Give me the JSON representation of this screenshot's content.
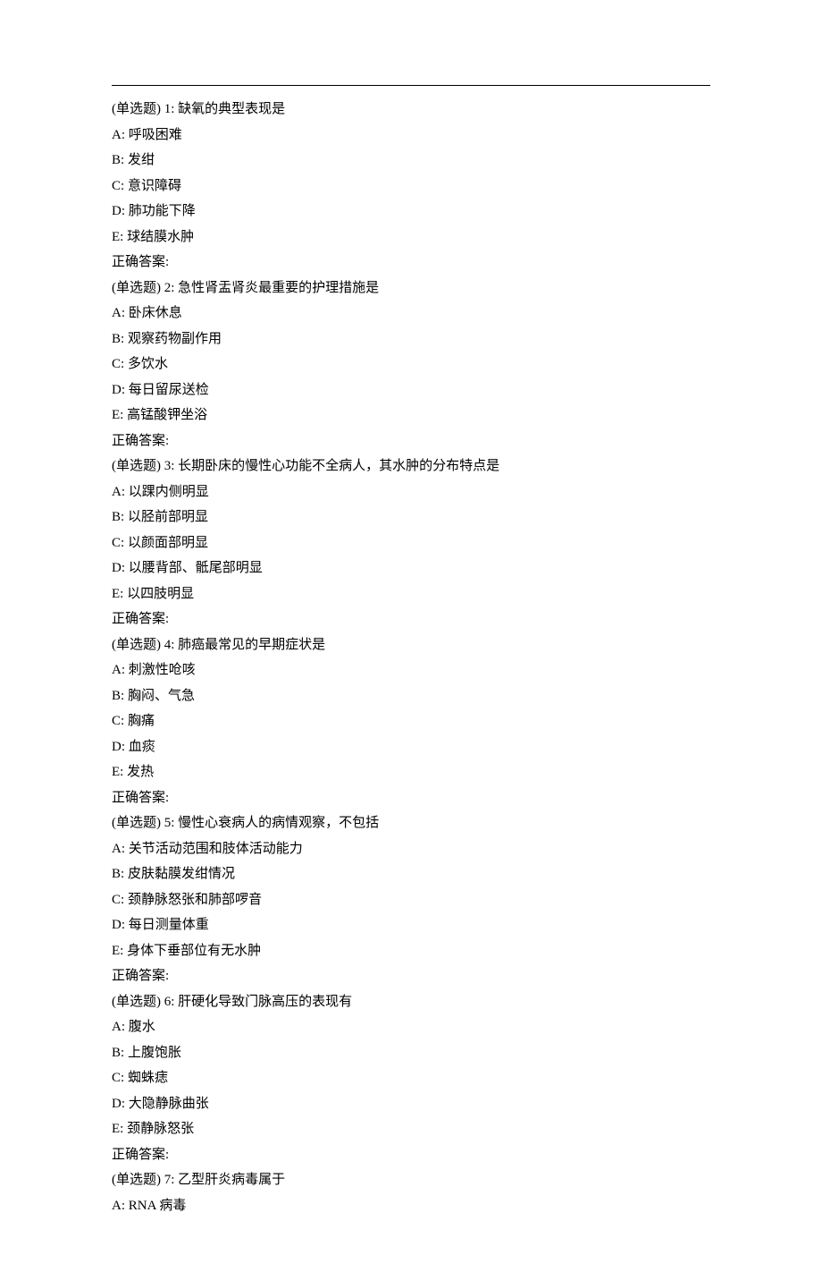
{
  "questions": [
    {
      "prefix": "(单选题)",
      "num": "1:",
      "stem": "缺氧的典型表现是",
      "options": [
        {
          "key": "A:",
          "text": "呼吸困难"
        },
        {
          "key": "B:",
          "text": "发绀"
        },
        {
          "key": "C:",
          "text": "意识障碍"
        },
        {
          "key": "D:",
          "text": "肺功能下降"
        },
        {
          "key": "E:",
          "text": "球结膜水肿"
        }
      ],
      "answer_label": "正确答案:"
    },
    {
      "prefix": "(单选题)",
      "num": "2:",
      "stem": "急性肾盂肾炎最重要的护理措施是",
      "options": [
        {
          "key": "A:",
          "text": "卧床休息"
        },
        {
          "key": "B:",
          "text": "观察药物副作用"
        },
        {
          "key": "C:",
          "text": "多饮水"
        },
        {
          "key": "D:",
          "text": "每日留尿送检"
        },
        {
          "key": "E:",
          "text": "高锰酸钾坐浴"
        }
      ],
      "answer_label": "正确答案:"
    },
    {
      "prefix": "(单选题)",
      "num": "3:",
      "stem": "长期卧床的慢性心功能不全病人，其水肿的分布特点是",
      "options": [
        {
          "key": "A:",
          "text": "以踝内侧明显"
        },
        {
          "key": "B:",
          "text": "以胫前部明显"
        },
        {
          "key": "C:",
          "text": "以颜面部明显"
        },
        {
          "key": "D:",
          "text": "以腰背部、骶尾部明显"
        },
        {
          "key": "E:",
          "text": "以四肢明显"
        }
      ],
      "answer_label": "正确答案:"
    },
    {
      "prefix": "(单选题)",
      "num": "4:",
      "stem": "肺癌最常见的早期症状是",
      "options": [
        {
          "key": "A:",
          "text": "刺激性呛咳"
        },
        {
          "key": "B:",
          "text": "胸闷、气急"
        },
        {
          "key": "C:",
          "text": "胸痛"
        },
        {
          "key": "D:",
          "text": "血痰"
        },
        {
          "key": "E:",
          "text": "发热"
        }
      ],
      "answer_label": "正确答案:"
    },
    {
      "prefix": "(单选题)",
      "num": "5:",
      "stem": "慢性心衰病人的病情观察，不包括",
      "options": [
        {
          "key": "A:",
          "text": "关节活动范围和肢体活动能力"
        },
        {
          "key": "B:",
          "text": "皮肤黏膜发绀情况"
        },
        {
          "key": "C:",
          "text": "颈静脉怒张和肺部啰音"
        },
        {
          "key": "D:",
          "text": "每日测量体重"
        },
        {
          "key": "E:",
          "text": "身体下垂部位有无水肿"
        }
      ],
      "answer_label": "正确答案:"
    },
    {
      "prefix": "(单选题)",
      "num": "6:",
      "stem": "肝硬化导致门脉高压的表现有",
      "options": [
        {
          "key": "A:",
          "text": "腹水"
        },
        {
          "key": "B:",
          "text": "上腹饱胀"
        },
        {
          "key": "C:",
          "text": "蜘蛛痣"
        },
        {
          "key": "D:",
          "text": "大隐静脉曲张"
        },
        {
          "key": "E:",
          "text": "颈静脉怒张"
        }
      ],
      "answer_label": "正确答案:"
    },
    {
      "prefix": "(单选题)",
      "num": "7:",
      "stem": "乙型肝炎病毒属于",
      "options": [
        {
          "key": "A:",
          "text": "RNA 病毒"
        }
      ],
      "answer_label": null
    }
  ]
}
